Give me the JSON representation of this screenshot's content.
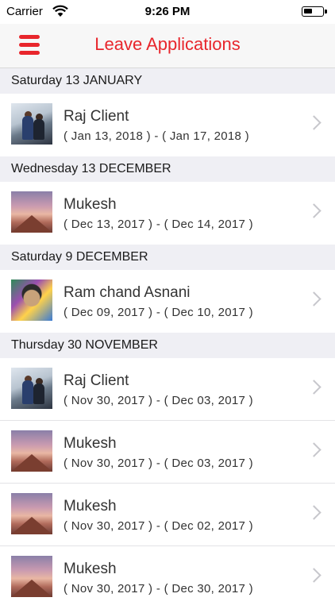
{
  "status_bar": {
    "carrier": "Carrier",
    "time": "9:26 PM"
  },
  "nav": {
    "title": "Leave Applications",
    "accent_color": "#e8262c",
    "menu_icon": "hamburger-menu-icon"
  },
  "sections": [
    {
      "header": "Saturday 13 JANUARY",
      "items": [
        {
          "name": "Raj Client",
          "dates": "( Jan 13, 2018 ) - ( Jan 17, 2018 )",
          "avatar": "snow-couple"
        }
      ]
    },
    {
      "header": "Wednesday 13 DECEMBER",
      "items": [
        {
          "name": "Mukesh",
          "dates": "( Dec 13, 2017 ) - ( Dec 14, 2017 )",
          "avatar": "mountain"
        }
      ]
    },
    {
      "header": "Saturday 9 DECEMBER",
      "items": [
        {
          "name": "Ram chand Asnani",
          "dates": "( Dec 09, 2017 ) - ( Dec 10, 2017 )",
          "avatar": "portrait"
        }
      ]
    },
    {
      "header": "Thursday 30 NOVEMBER",
      "items": [
        {
          "name": "Raj Client",
          "dates": "( Nov 30, 2017 ) - ( Dec 03, 2017 )",
          "avatar": "snow-couple"
        },
        {
          "name": "Mukesh",
          "dates": "( Nov 30, 2017 ) - ( Dec 03, 2017 )",
          "avatar": "mountain"
        },
        {
          "name": "Mukesh",
          "dates": "( Nov 30, 2017 ) - ( Dec 02, 2017 )",
          "avatar": "mountain"
        },
        {
          "name": "Mukesh",
          "dates": "( Nov 30, 2017 ) - ( Dec 30, 2017 )",
          "avatar": "mountain"
        }
      ]
    }
  ]
}
